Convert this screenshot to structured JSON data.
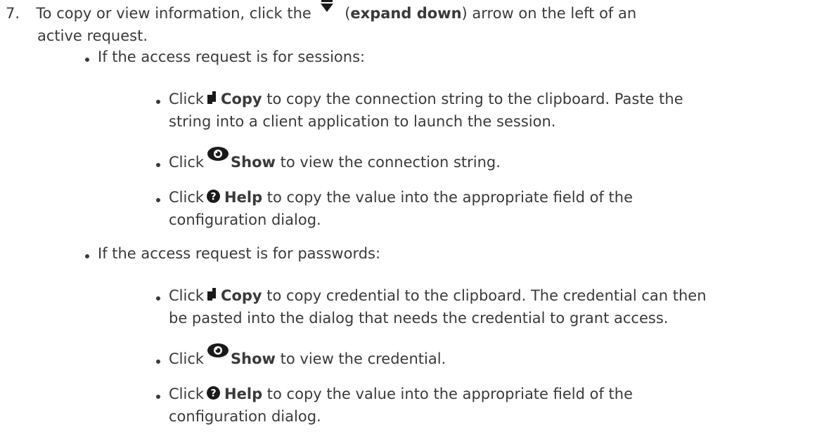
{
  "step": {
    "number": "7.",
    "text_before": "To copy or view information, click the",
    "expand_label": "expand down",
    "text_after_open": "(",
    "text_after": ") arrow on the left of an",
    "line2": "active request.",
    "expand_icon": "caret-down-icon"
  },
  "sessions": {
    "heading": "If the access request is for sessions:",
    "copy": {
      "click": "Click",
      "icon": "copy-icon",
      "label": "Copy",
      "rest_line1": "to copy the connection string to the clipboard. Paste the",
      "line2": "string into a client application to launch the session."
    },
    "show": {
      "click": "Click",
      "icon": "eye-icon",
      "label": "Show",
      "rest": "to view the connection string."
    },
    "help": {
      "click": "Click",
      "icon": "question-circle-icon",
      "label": "Help",
      "rest_line1": "to copy the value into the appropriate field of the",
      "line2": "configuration dialog."
    }
  },
  "passwords": {
    "heading": "If the access request is for passwords:",
    "copy": {
      "click": "Click",
      "icon": "copy-icon",
      "label": "Copy",
      "rest_line1": "to copy credential to the clipboard. The credential can then",
      "line2": "be pasted into the dialog that needs the credential to grant access."
    },
    "show": {
      "click": "Click",
      "icon": "eye-icon",
      "label": "Show",
      "rest": "to view the credential."
    },
    "help": {
      "click": "Click",
      "icon": "question-circle-icon",
      "label": "Help",
      "rest_line1": "to copy the value into the appropriate field of the",
      "line2": "configuration dialog."
    }
  },
  "colors": {
    "text": "#3a3a3a",
    "icon": "#1a1a1a"
  }
}
